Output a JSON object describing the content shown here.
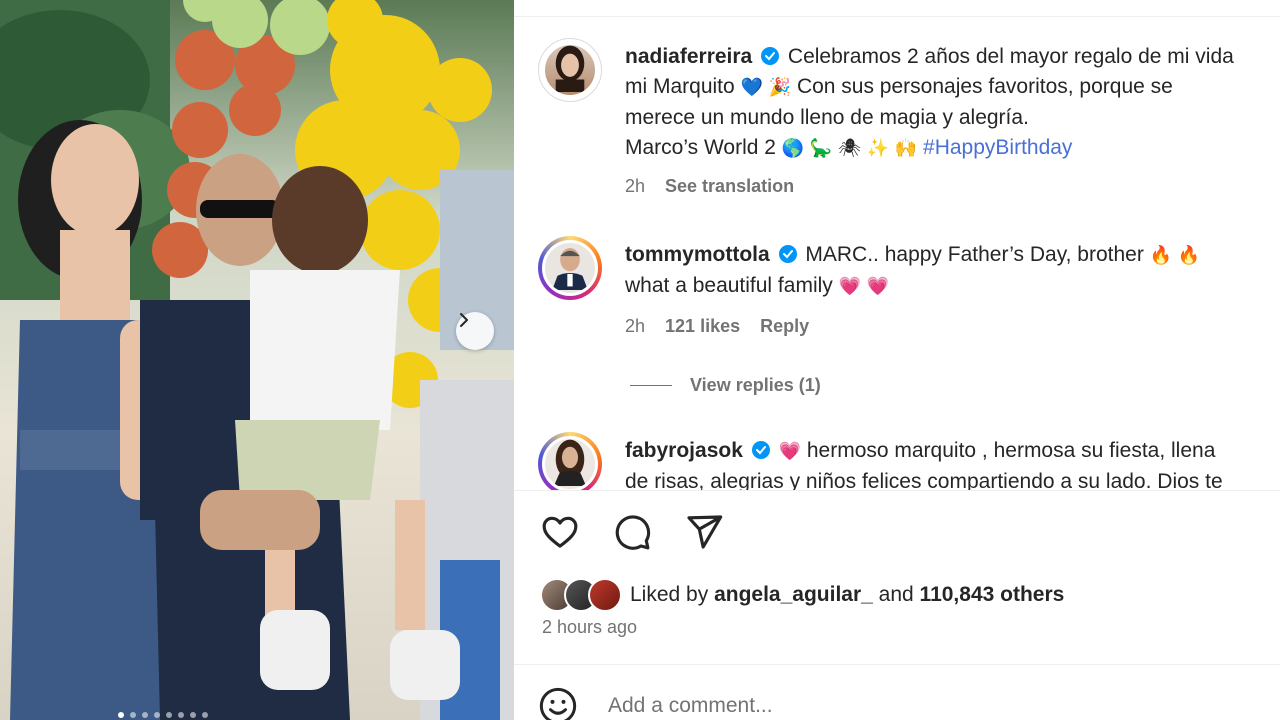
{
  "post": {
    "carousel_dots": 8,
    "active_dot": 0
  },
  "caption": {
    "username": "nadiaferreira",
    "text_line1": "Celebramos 2 años del mayor regalo de mi vida",
    "text_line2_a": "mi Marquito",
    "emoji_line2": "💙 🎉",
    "text_line2_b": "Con sus personajes favoritos, porque se",
    "text_line3": "merece un mundo lleno de magia y alegría.",
    "text_line4": "Marco’s World 2",
    "emoji_line4": "🌎 🦕 🕷 ✨ 🙌",
    "hashtag": "#HappyBirthday",
    "time": "2h",
    "see_translation": "See translation"
  },
  "comments": [
    {
      "username": "tommymottola",
      "text_a": "MARC.. happy Father’s Day, brother",
      "emoji_a": "🔥 🔥",
      "text_b": "what a beautiful family",
      "emoji_b": "💗 💗",
      "time": "2h",
      "likes": "121 likes",
      "reply": "Reply",
      "view_replies": "View replies (1)"
    },
    {
      "username": "fabyrojasok",
      "emoji": "💗",
      "text_a": "hermoso marquito , hermosa su fiesta, llena",
      "text_b": "de risas, alegrias y niños felices compartiendo a su lado. Dios te"
    }
  ],
  "likes": {
    "prefix": "Liked by",
    "user": "angela_aguilar_",
    "conj": "and",
    "others": "110,843 others",
    "posted": "2 hours ago"
  },
  "composer": {
    "placeholder": "Add a comment..."
  },
  "colors": {
    "verified": "#0095f6",
    "hashtag": "#4a6fd6",
    "muted": "#737373"
  },
  "icons": [
    "heart-icon",
    "comment-icon",
    "share-icon",
    "emoji-icon",
    "verified-icon",
    "chevron-right-icon"
  ]
}
